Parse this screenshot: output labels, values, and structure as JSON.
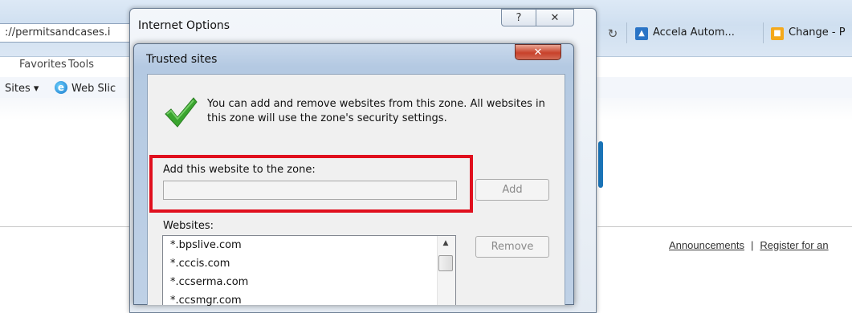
{
  "browser": {
    "address_text": "://permitsandcases.i",
    "menu": {
      "favorites": "Favorites",
      "tools": "Tools"
    },
    "favorites_bar": {
      "sites": "Sites ▾",
      "web_slice": "Web Slic"
    },
    "refresh_glyph": "↻",
    "tabs": [
      {
        "label": "Accela Autom...",
        "icon": "accela-icon"
      },
      {
        "label": "Change - P",
        "icon": "change-icon"
      }
    ]
  },
  "page": {
    "footer": {
      "announcements": "Announcements",
      "separator": "|",
      "register": "Register for an"
    }
  },
  "internet_options": {
    "title": "Internet Options",
    "help_glyph": "?",
    "close_glyph": "✕"
  },
  "trusted_sites": {
    "title": "Trusted sites",
    "close_glyph": "✕",
    "info": "You can add and remove websites from this zone. All websites in this zone will use the zone's security settings.",
    "add_label": "Add this website to the zone:",
    "add_input_value": "",
    "add_button": "Add",
    "websites_label": "Websites:",
    "websites": [
      "*.bpslive.com",
      "*.cccis.com",
      "*.ccserma.com",
      "*.ccsmgr.com"
    ],
    "remove_button": "Remove"
  },
  "colors": {
    "highlight": "#e0101e",
    "close_red": "#c8412a",
    "check_green": "#3aa52f"
  }
}
